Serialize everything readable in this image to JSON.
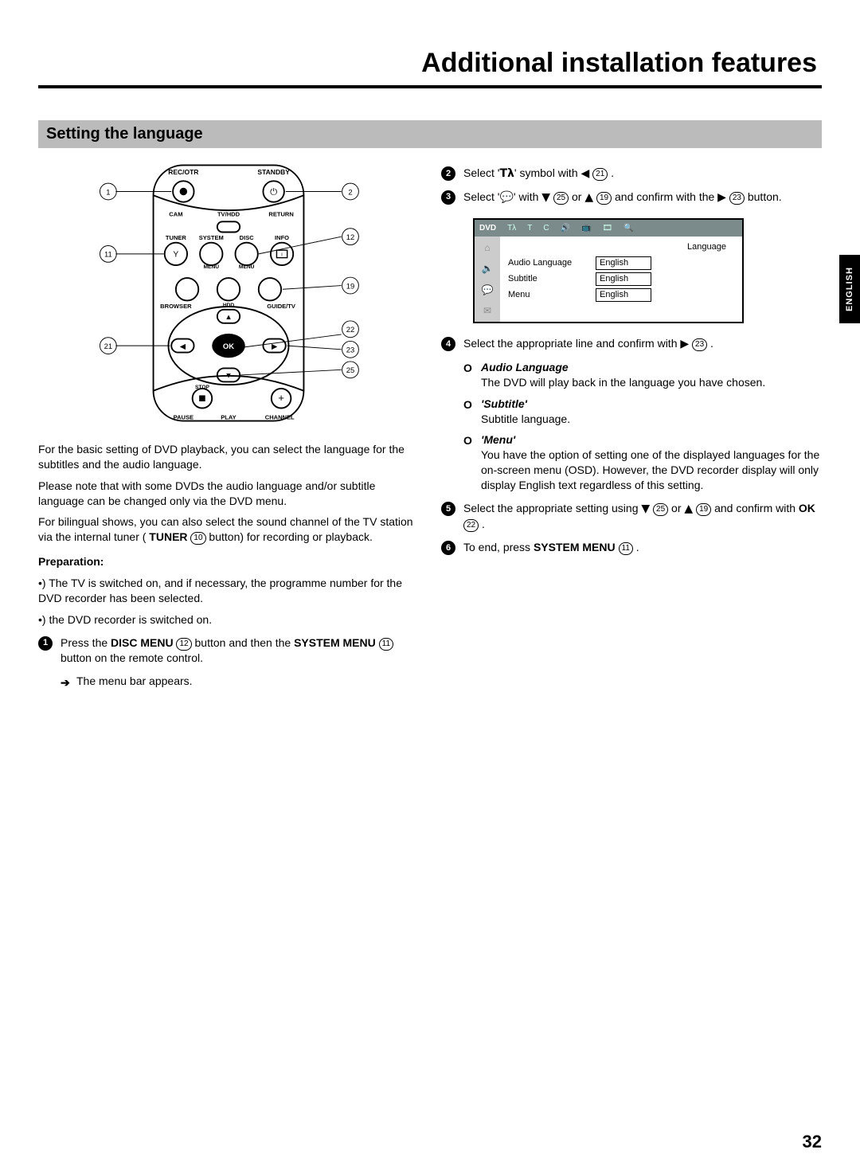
{
  "title": "Additional installation features",
  "language_tab": "ENGLISH",
  "page_number": "32",
  "section": {
    "heading": "Setting the language"
  },
  "remote": {
    "labels": {
      "rec_otr": "REC/OTR",
      "standby": "STANDBY",
      "cam": "CAM",
      "tvhdd": "TV/HDD",
      "return": "RETURN",
      "tuner": "TUNER",
      "system": "SYSTEM",
      "menu": "MENU",
      "disc": "DISC",
      "info": "INFO",
      "browser": "BROWSER",
      "hdd": "HDD",
      "guide": "GUIDE/TV",
      "ok": "OK",
      "stop": "STOP",
      "pause": "PAUSE",
      "play": "PLAY",
      "channel": "CHANNEL"
    },
    "callouts": {
      "c1": "1",
      "c2": "2",
      "c11": "11",
      "c12": "12",
      "c19": "19",
      "c21": "21",
      "c22": "22",
      "c23": "23",
      "c25": "25"
    }
  },
  "left": {
    "p1": "For the basic setting of DVD playback, you can select the language for the subtitles and the audio language.",
    "p2": "Please note that with some DVDs the audio language and/or subtitle language can be changed only via the DVD menu.",
    "p3a": "For bilingual shows, you can also select the sound channel of the TV station via the internal tuner ( ",
    "p3_b1": "TUNER",
    "p3_cn": "10",
    "p3b": " button) for recording or playback.",
    "prep_head": "Preparation:",
    "prep1": "•) The TV is switched on, and if necessary, the programme number for the DVD recorder has been selected.",
    "prep2": "•) the DVD recorder is switched on",
    "step1a": "Press the ",
    "step1_b1": "DISC MENU",
    "step1_cn1": "12",
    "step1b": " button and then the ",
    "step1_b2": "SYSTEM MENU",
    "step1_cn2": "11",
    "step1c": " button on the remote control.",
    "step1_sub": "The menu bar appears."
  },
  "right": {
    "step2a": "Select '",
    "step2_sym": "Tλ",
    "step2b": "' symbol with ",
    "step2_arrow": "◀",
    "step2_cn": "21",
    "step2c": " .",
    "step3a": "Select '",
    "step3_sym": "💬",
    "step3b": "' with ",
    "step3_d": "▼",
    "step3_cn1": "25",
    "step3c": " or ",
    "step3_u": "▲",
    "step3_cn2": "19",
    "step3d": " and confirm with the ",
    "step3_r": "▶",
    "step3_cn3": "23",
    "step3e": " button.",
    "osd": {
      "top_hint": "DVD",
      "tabs": [
        "Tλ",
        "T",
        "C",
        "🔊",
        "📺",
        "🎞",
        "🔍"
      ],
      "heading": "Language",
      "rows": [
        {
          "label": "Audio Language",
          "value": "English"
        },
        {
          "label": "Subtitle",
          "value": "English"
        },
        {
          "label": "Menu",
          "value": "English"
        }
      ]
    },
    "step4a": "Select the appropriate line and confirm with ",
    "step4_r": "▶",
    "step4_cn": "23",
    "step4b": " .",
    "opts": {
      "o1_title": "Audio Language",
      "o1_text": "The DVD will play back in the language you have chosen.",
      "o2_title": "'Subtitle'",
      "o2_text": "Subtitle language.",
      "o3_title": "'Menu'",
      "o3_text": "You have the option of setting one of the displayed languages for the on-screen menu (OSD). However, the DVD recorder display will only display English text regardless of this setting."
    },
    "step5a": "Select the appropriate setting using ",
    "step5_d": "▼",
    "step5_cn1": "25",
    "step5b": " or ",
    "step5_u": "▲",
    "step5_cn2": "19",
    "step5c": " and confirm with ",
    "step5_ok": "OK",
    "step5_cn3": "22",
    "step5d": " .",
    "step6a": "To end, press ",
    "step6_b": "SYSTEM MENU",
    "step6_cn": "11",
    "step6b": " ."
  }
}
